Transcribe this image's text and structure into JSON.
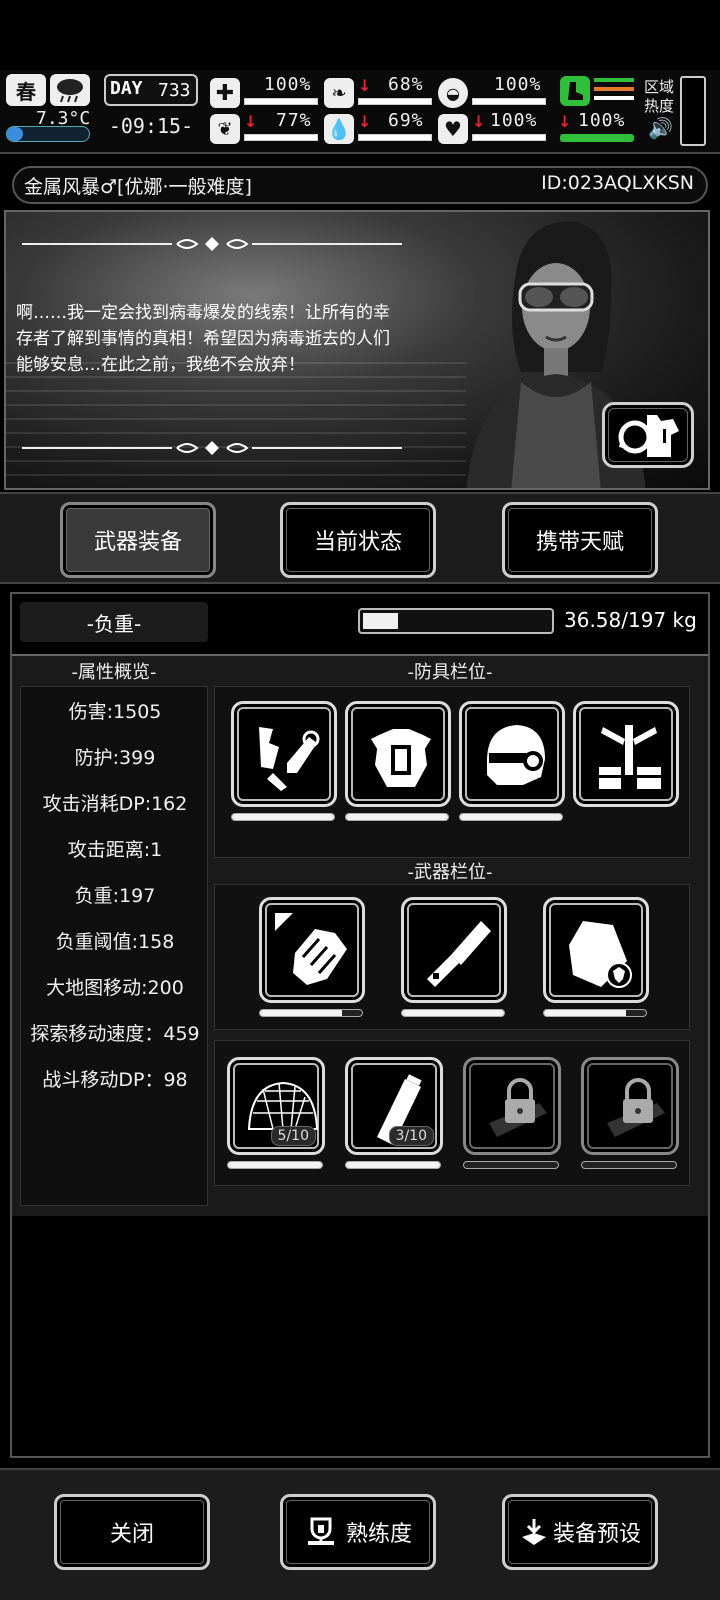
{
  "hud": {
    "season": "春",
    "temperature": "7.3°C",
    "day_label": "DAY",
    "day_number": "733",
    "time": "-09:15-",
    "zone_heat_label": "区域热度",
    "stats": [
      {
        "name": "health",
        "icon": "medkit-icon",
        "value": "100%",
        "level": 1.0,
        "down": false
      },
      {
        "name": "hunger",
        "icon": "stomach-icon",
        "value": "68%",
        "level": 0.68,
        "down": true
      },
      {
        "name": "stamina",
        "icon": "capsule-icon",
        "value": "100%",
        "level": 1.0,
        "down": false
      },
      {
        "name": "mental",
        "icon": "brain-icon",
        "value": "77%",
        "level": 0.77,
        "down": true
      },
      {
        "name": "thirst",
        "icon": "water-drop-icon",
        "value": "69%",
        "level": 0.69,
        "down": true
      },
      {
        "name": "mood",
        "icon": "heart-icon",
        "value": "100%",
        "level": 1.0,
        "down": true
      },
      {
        "name": "leg",
        "icon": "boot-icon",
        "value": "100%",
        "level": 1.0,
        "down": true
      }
    ]
  },
  "title": {
    "game": "金属风暴♂[优娜·一般难度]",
    "id": "ID:023AQLXKSN"
  },
  "dialog": "啊……我一定会找到病毒爆发的线索！让所有的幸存者了解到事情的真相！希望因为病毒逝去的人们能够安息…在此之前，我绝不会放弃！",
  "tabs": {
    "weapons": "武器装备",
    "status": "当前状态",
    "talent": "携带天赋"
  },
  "load": {
    "label": "-负重-",
    "value": "36.58/197 kg",
    "fraction": 0.186
  },
  "attributes": {
    "header": "-属性概览-",
    "items": [
      "伤害:1505",
      "防护:399",
      "攻击消耗DP:162",
      "攻击距离:1",
      "负重:197",
      "负重阈值:158",
      "大地图移动:200",
      "探索移动速度：459",
      "战斗移动DP：98"
    ]
  },
  "armor": {
    "header": "-防具栏位-",
    "slots": [
      {
        "icon": "arm-guard-icon",
        "durability": 1.0
      },
      {
        "icon": "body-armor-icon",
        "durability": 1.0
      },
      {
        "icon": "helmet-icon",
        "durability": 1.0
      },
      {
        "icon": "backpack-frame-icon",
        "durability": null
      }
    ]
  },
  "weapons": {
    "header": "-武器栏位-",
    "slots": [
      {
        "icon": "power-gauntlet-icon",
        "durability": 0.8
      },
      {
        "icon": "machete-icon",
        "durability": 1.0
      },
      {
        "icon": "riot-shield-icon",
        "durability": 0.8
      }
    ]
  },
  "consumables": {
    "slots": [
      {
        "icon": "net-icon",
        "count": "5/10",
        "durability": 1.0
      },
      {
        "icon": "throwable-canister-icon",
        "count": "3/10",
        "durability": 1.0
      },
      {
        "icon": "lock-icon",
        "count": null,
        "durability": 0
      },
      {
        "icon": "lock-icon",
        "count": null,
        "durability": 0
      }
    ]
  },
  "footer": {
    "close": "关闭",
    "proficiency": "熟练度",
    "preset": "装备预设"
  },
  "colors": {
    "background": "#000000",
    "accent_green": "#2fbf3a",
    "alert_red": "#e22233",
    "orange": "#e27a2a"
  }
}
